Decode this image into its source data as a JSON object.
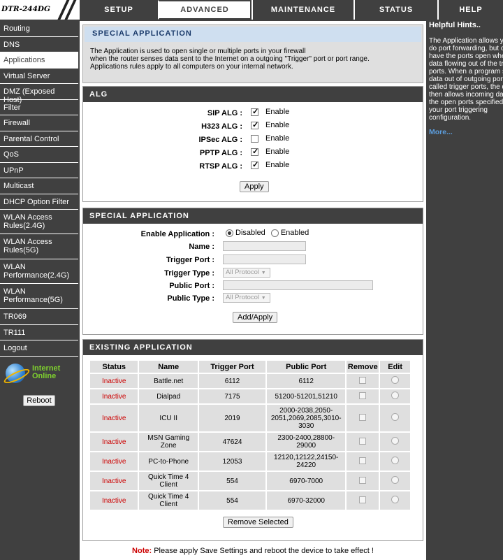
{
  "header": {
    "logo": "DTR-244DG",
    "tabs": [
      {
        "label": "SETUP"
      },
      {
        "label": "ADVANCED"
      },
      {
        "label": "MAINTENANCE"
      },
      {
        "label": "STATUS"
      },
      {
        "label": "HELP"
      }
    ],
    "active_tab": "ADVANCED"
  },
  "sidebar": {
    "items": [
      {
        "label": "Routing"
      },
      {
        "label": "DNS"
      },
      {
        "label": "Applications"
      },
      {
        "label": "Virtual Server"
      },
      {
        "label": "DMZ (Exposed Host)"
      },
      {
        "label": "Filter"
      },
      {
        "label": "Firewall"
      },
      {
        "label": "Parental Control"
      },
      {
        "label": "QoS"
      },
      {
        "label": "UPnP"
      },
      {
        "label": "Multicast"
      },
      {
        "label": "DHCP Option Filter"
      },
      {
        "label": "WLAN Access Rules(2.4G)"
      },
      {
        "label": "WLAN Access Rules(5G)"
      },
      {
        "label": "WLAN Performance(2.4G)"
      },
      {
        "label": "WLAN Performance(5G)"
      },
      {
        "label": "TR069"
      },
      {
        "label": "TR111"
      },
      {
        "label": "Logout"
      }
    ],
    "active_item": "Applications",
    "internet_status_line1": "Internet",
    "internet_status_line2": "Online",
    "reboot_label": "Reboot"
  },
  "intro": {
    "title": "SPECIAL APPLICATION",
    "line1": "The Application is used to open single or multiple ports in your firewall",
    "line2": "when the router senses data sent to the Internet on a outgoing \"Trigger\" port or port range.",
    "line3": "Applications rules apply to all computers on your internal network."
  },
  "alg": {
    "title": "ALG",
    "rows": [
      {
        "label": "SIP ALG :",
        "checked": true,
        "text": "Enable"
      },
      {
        "label": "H323 ALG :",
        "checked": true,
        "text": "Enable"
      },
      {
        "label": "IPSec ALG :",
        "checked": false,
        "text": "Enable"
      },
      {
        "label": "PPTP ALG :",
        "checked": true,
        "text": "Enable"
      },
      {
        "label": "RTSP ALG :",
        "checked": true,
        "text": "Enable"
      }
    ],
    "apply_label": "Apply"
  },
  "special_app": {
    "title": "SPECIAL APPLICATION",
    "enable_label": "Enable Application :",
    "disabled_text": "Disabled",
    "enabled_text": "Enabled",
    "selected": "Disabled",
    "name_label": "Name :",
    "name_value": "",
    "trigger_port_label": "Trigger Port :",
    "trigger_port_value": "",
    "trigger_type_label": "Trigger Type :",
    "trigger_type_value": "All Protocol",
    "public_port_label": "Public Port :",
    "public_port_value": "",
    "public_type_label": "Public Type :",
    "public_type_value": "All Protocol",
    "add_apply_label": "Add/Apply"
  },
  "existing": {
    "title": "EXISTING APPLICATION",
    "columns": [
      "Status",
      "Name",
      "Trigger Port",
      "Public Port",
      "Remove",
      "Edit"
    ],
    "rows": [
      {
        "status": "Inactive",
        "name": "Battle.net",
        "trigger": "6112",
        "public": "6112"
      },
      {
        "status": "Inactive",
        "name": "Dialpad",
        "trigger": "7175",
        "public": "51200-51201,51210"
      },
      {
        "status": "Inactive",
        "name": "ICU II",
        "trigger": "2019",
        "public": "2000-2038,2050-2051,2069,2085,3010-3030"
      },
      {
        "status": "Inactive",
        "name": "MSN Gaming Zone",
        "trigger": "47624",
        "public": "2300-2400,28800-29000"
      },
      {
        "status": "Inactive",
        "name": "PC-to-Phone",
        "trigger": "12053",
        "public": "12120,12122,24150-24220"
      },
      {
        "status": "Inactive",
        "name": "Quick Time 4 Client",
        "trigger": "554",
        "public": "6970-7000"
      },
      {
        "status": "Inactive",
        "name": "Quick Time 4 Client",
        "trigger": "554",
        "public": "6970-32000"
      }
    ],
    "remove_selected_label": "Remove Selected"
  },
  "note": {
    "prefix": "Note:",
    "text": " Please apply Save Settings and reboot the device to take effect !"
  },
  "hints": {
    "title": "Helpful Hints..",
    "body": "The Application allows you to do port forwarding, but only have the ports open when data flowing out of the trigger ports. When a program sends data out of outgoing ports called trigger ports, the device then allows incoming data on the open ports specified in your port triggering configuration.",
    "more": "More..."
  },
  "colors": {
    "nav_bg": "#404040",
    "inactive": "#cc0000",
    "online": "#7fd12e",
    "hint_link": "#5c9ede"
  }
}
